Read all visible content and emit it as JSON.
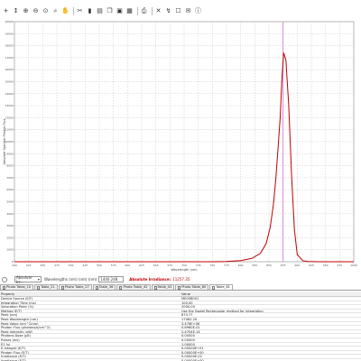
{
  "toolbar": {
    "icons": [
      "plus-icon",
      "zoom-in-icon",
      "zoom-out-icon",
      "zoom-fit-icon",
      "pan-icon",
      "cut-icon",
      "clipboard-icon",
      "copy-icon",
      "paste-icon",
      "print-icon",
      "tools-icon",
      "chart-settings-icon",
      "checkbox-icon",
      "email-icon",
      "info-icon"
    ]
  },
  "chart_data": {
    "type": "line",
    "xlabel": "Wavelength (nm)",
    "ylabel": "Absolute Spectral Photon Flux",
    "xlim": [
      400,
      1000
    ],
    "ylim": [
      0,
      20000
    ],
    "grid": true,
    "line_color": "#c00000",
    "marker_line_color": "#d070d0",
    "marker_x": 875,
    "x": [
      400,
      500,
      600,
      700,
      750,
      775,
      800,
      820,
      835,
      845,
      852,
      858,
      862,
      866,
      870,
      873,
      876,
      880,
      885,
      890,
      895,
      900,
      910,
      920,
      940,
      960,
      980,
      1000
    ],
    "y": [
      0,
      0,
      0,
      0,
      0,
      20,
      90,
      280,
      700,
      1500,
      2800,
      4800,
      6800,
      9400,
      12100,
      15300,
      17400,
      16800,
      13000,
      7200,
      2700,
      600,
      80,
      20,
      0,
      0,
      0,
      0
    ]
  },
  "status": {
    "combo_value": "Absolute Irr...",
    "wavelength_label": "Wavelengths (nm) (nm) (nm)",
    "wavelength_value": "1440.248",
    "irradiance_label": "Absolute Irradiance:",
    "irradiance_value": "11257.35"
  },
  "tabs": [
    {
      "label": "Photo Table_10"
    },
    {
      "label": "Table_21"
    },
    {
      "label": "Photo Table_27"
    },
    {
      "label": "Table_36"
    },
    {
      "label": "Photo Table_42"
    },
    {
      "label": "Table_43"
    },
    {
      "label": "Photo Table_60"
    },
    {
      "label": "Table_61"
    }
  ],
  "table": {
    "headers": {
      "property": "Property",
      "value": "Value"
    },
    "rows": [
      {
        "property": "Device Source (E/T)",
        "value": "ME05B001"
      },
      {
        "property": "Integration Time (ms)",
        "value": "100.00"
      },
      {
        "property": "Saturation Point (%)",
        "value": "2000.00"
      },
      {
        "property": "Method (E/T)",
        "value": "Use the Sweet Rectangular method for integration"
      },
      {
        "property": "Peak (nm)",
        "value": "874.77"
      },
      {
        "property": "Peak Wavelength (nm)",
        "value": "17462.20"
      },
      {
        "property": "Peak Value (nm^2/nm)",
        "value": "3.476E+06"
      },
      {
        "property": "Photon Flux (photons/s/cm^2)",
        "value": "0.8960E-01"
      },
      {
        "property": "Peak Intensity (uW)",
        "value": "2.4704E-14"
      },
      {
        "property": "Photons Dose (µE)",
        "value": "0.00000"
      },
      {
        "property": "Pulses (ms)",
        "value": "0.00000"
      },
      {
        "property": "E1 (s)",
        "value": "1.00000"
      },
      {
        "property": "E-Integral (E/T)",
        "value": "0.00000E+01"
      },
      {
        "property": "Photon Flux (E/T)",
        "value": "0.00000E+00"
      },
      {
        "property": "Irradiance (E/T)",
        "value": "0.00000E-01"
      },
      {
        "property": "Irradiance (E/T)",
        "value": "0.00000E+00"
      }
    ]
  }
}
